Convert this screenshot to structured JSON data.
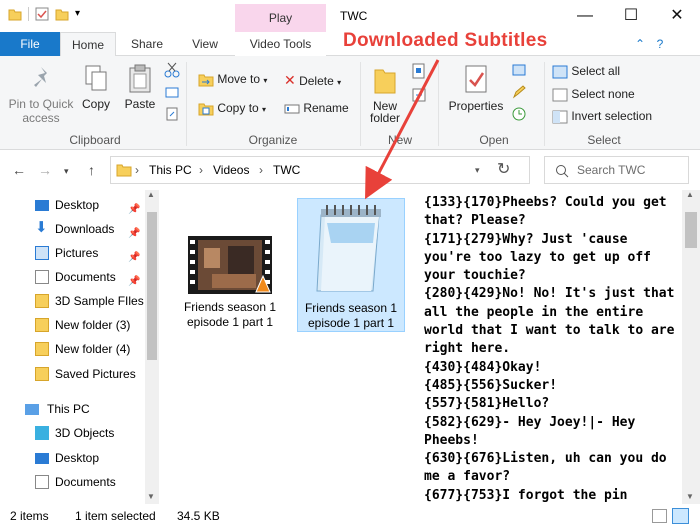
{
  "window": {
    "title": "TWC",
    "context_tab": "Play"
  },
  "tabs": {
    "file": "File",
    "home": "Home",
    "share": "Share",
    "view": "View",
    "video_tools": "Video Tools"
  },
  "ribbon": {
    "clipboard": {
      "pin_line1": "Pin to Quick",
      "pin_line2": "access",
      "copy": "Copy",
      "paste": "Paste",
      "label": "Clipboard"
    },
    "organize": {
      "move_to": "Move to",
      "copy_to": "Copy to",
      "delete": "Delete",
      "rename": "Rename",
      "label": "Organize"
    },
    "new": {
      "new_folder_line1": "New",
      "new_folder_line2": "folder",
      "label": "New"
    },
    "open": {
      "properties": "Properties",
      "label": "Open"
    },
    "select": {
      "select_all": "Select all",
      "select_none": "Select none",
      "invert": "Invert selection",
      "label": "Select"
    }
  },
  "address": {
    "crumbs": [
      "This PC",
      "Videos",
      "TWC"
    ],
    "search_placeholder": "Search TWC"
  },
  "nav": {
    "items": [
      {
        "label": "Desktop",
        "pinned": true
      },
      {
        "label": "Downloads",
        "pinned": true
      },
      {
        "label": "Pictures",
        "pinned": true
      },
      {
        "label": "Documents",
        "pinned": true
      },
      {
        "label": "3D Sample FIles",
        "pinned": false
      },
      {
        "label": "New folder (3)",
        "pinned": false
      },
      {
        "label": "New folder (4)",
        "pinned": false
      },
      {
        "label": "Saved Pictures",
        "pinned": false
      },
      {
        "label": "This PC",
        "pinned": false
      },
      {
        "label": "3D Objects",
        "pinned": false
      },
      {
        "label": "Desktop",
        "pinned": false
      },
      {
        "label": "Documents",
        "pinned": false
      }
    ]
  },
  "files": [
    {
      "line1": "Friends season 1",
      "line2": "episode 1 part 1",
      "type": "video"
    },
    {
      "line1": "Friends season 1",
      "line2": "episode 1 part 1",
      "type": "text"
    }
  ],
  "preview_text": "{133}{170}Pheebs? Could you get that? Please?\n{171}{279}Why? Just 'cause you're too lazy to get up off your touchie?\n{280}{429}No! No! It's just that all the people in the entire world that I want to talk to are right here.\n{430}{484}Okay!\n{485}{556}Sucker!\n{557}{581}Hello?\n{582}{629}- Hey Joey!|- Hey Pheebs!\n{630}{676}Listen, uh can you do me a favor?\n{677}{753}I forgot the pin",
  "status": {
    "items": "2 items",
    "selected": "1 item selected",
    "size": "34.5 KB"
  },
  "annotation": "Downloaded Subtitles",
  "colors": {
    "file_tab": "#1979ca",
    "context_tab": "#f9d6ec",
    "selection": "#cce8ff",
    "annotation": "#e8413a"
  }
}
